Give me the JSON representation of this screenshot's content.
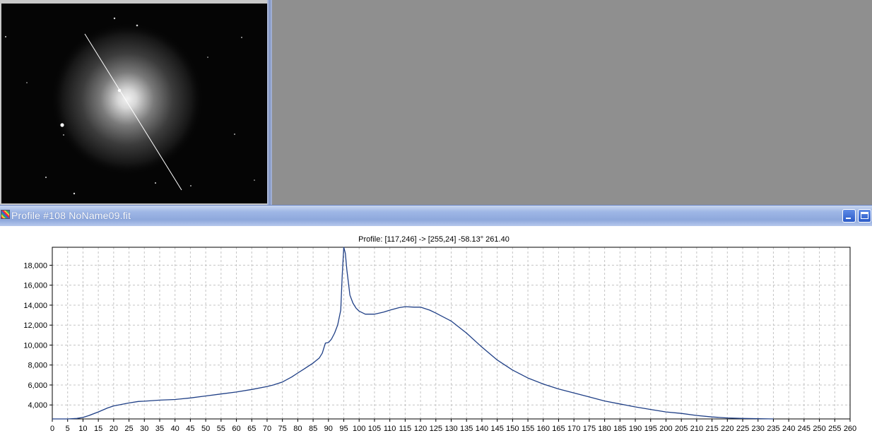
{
  "window": {
    "title": "Profile #108 NoName09.fit"
  },
  "image_view": {
    "description_icon": "fits-image-icon"
  },
  "chart_data": {
    "type": "line",
    "title": "Profile: [117,246] -> [255,24] -58.13° 261.40",
    "xlabel": "",
    "ylabel": "",
    "xlim": [
      0,
      260
    ],
    "ylim": [
      2600,
      19800
    ],
    "grid": true,
    "x_ticks": [
      0,
      5,
      10,
      15,
      20,
      25,
      30,
      35,
      40,
      45,
      50,
      55,
      60,
      65,
      70,
      75,
      80,
      85,
      90,
      95,
      100,
      105,
      110,
      115,
      120,
      125,
      130,
      135,
      140,
      145,
      150,
      155,
      160,
      165,
      170,
      175,
      180,
      185,
      190,
      195,
      200,
      205,
      210,
      215,
      220,
      225,
      230,
      235,
      240,
      245,
      250,
      255,
      260
    ],
    "y_ticks": [
      4000,
      6000,
      8000,
      10000,
      12000,
      14000,
      16000,
      18000
    ],
    "y_tick_labels": [
      "4,000",
      "6,000",
      "8,000",
      "10,000",
      "12,000",
      "14,000",
      "16,000",
      "18,000"
    ],
    "color": "#1f3f86",
    "series": [
      {
        "x": [
          0,
          5,
          8,
          10,
          12,
          15,
          18,
          20,
          25,
          28,
          30,
          35,
          40,
          45,
          50,
          55,
          60,
          65,
          70,
          72,
          75,
          78,
          80,
          82,
          85,
          87,
          88,
          89,
          90,
          91,
          92,
          93,
          94,
          94.5,
          95,
          95.5,
          96,
          97,
          98,
          99,
          100,
          102,
          105,
          108,
          110,
          113,
          115,
          118,
          120,
          123,
          125,
          130,
          135,
          140,
          145,
          150,
          155,
          160,
          165,
          170,
          175,
          180,
          185,
          190,
          195,
          200,
          205,
          210,
          215,
          220,
          225,
          230,
          235
        ],
        "y": [
          2600,
          2600,
          2650,
          2750,
          2950,
          3300,
          3700,
          3900,
          4200,
          4350,
          4380,
          4480,
          4550,
          4700,
          4900,
          5100,
          5300,
          5550,
          5850,
          6000,
          6300,
          6800,
          7200,
          7600,
          8200,
          8700,
          9200,
          10200,
          10250,
          10600,
          11200,
          12000,
          13500,
          17000,
          19800,
          19200,
          17500,
          15000,
          14200,
          13700,
          13400,
          13100,
          13100,
          13300,
          13500,
          13750,
          13850,
          13800,
          13800,
          13500,
          13200,
          12400,
          11200,
          9800,
          8500,
          7500,
          6700,
          6100,
          5600,
          5200,
          4800,
          4400,
          4100,
          3800,
          3550,
          3300,
          3150,
          2950,
          2800,
          2700,
          2650,
          2630,
          2600
        ]
      }
    ]
  }
}
